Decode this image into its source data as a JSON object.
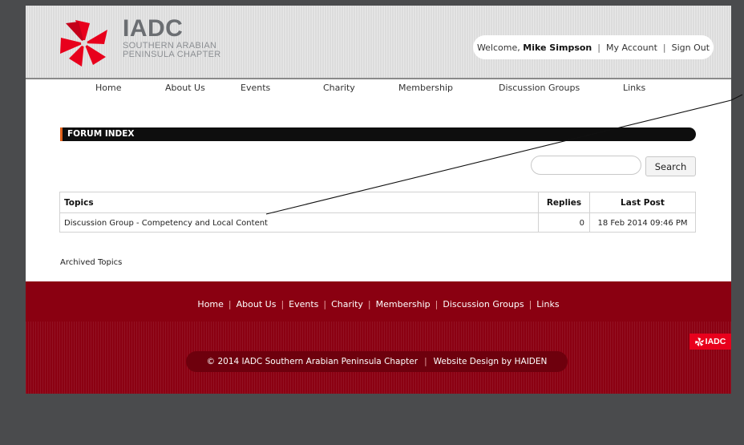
{
  "header": {
    "logo_title": "IADC",
    "logo_subtitle_line1": "SOUTHERN ARABIAN",
    "logo_subtitle_line2": "PENINSULA CHAPTER",
    "welcome_prefix": "Welcome,",
    "user_name": "Mike Simpson",
    "my_account": "My Account",
    "sign_out": "Sign Out"
  },
  "nav": {
    "items": [
      "Home",
      "About Us",
      "Events",
      "Charity",
      "Membership",
      "Discussion Groups",
      "Links"
    ]
  },
  "forum": {
    "title": "FORUM INDEX",
    "search_button": "Search",
    "search_placeholder": "",
    "table": {
      "headers": [
        "Topics",
        "Replies",
        "Last Post"
      ],
      "rows": [
        {
          "topic": "Discussion Group - Competency and Local Content",
          "replies": "0",
          "last_post": "18 Feb 2014 09:46 PM"
        }
      ]
    },
    "archived_link": "Archived Topics"
  },
  "footer": {
    "nav": [
      "Home",
      "About Us",
      "Events",
      "Charity",
      "Membership",
      "Discussion Groups",
      "Links"
    ],
    "copyright": "© 2014 IADC Southern Arabian Peninsula Chapter",
    "design_credit": "Website Design by HAIDEN",
    "badge_text": "IADC"
  },
  "colors": {
    "brand_red": "#e8001c",
    "footer_red": "#8b0012",
    "forum_bar": "#0e0e0e",
    "accent_orange": "#e0601a"
  }
}
